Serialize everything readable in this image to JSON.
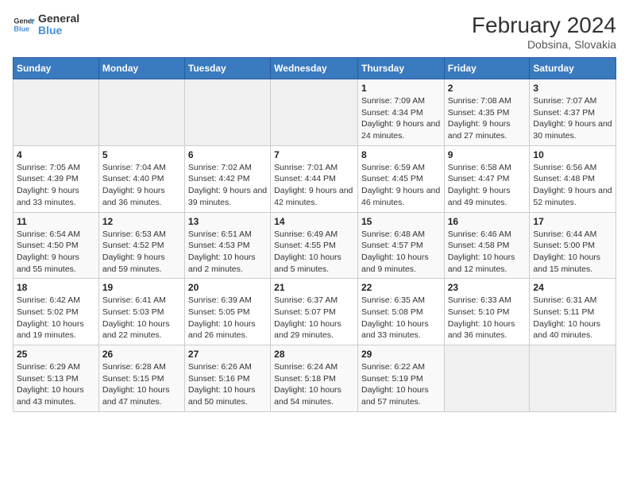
{
  "header": {
    "logo_line1": "General",
    "logo_line2": "Blue",
    "title": "February 2024",
    "subtitle": "Dobsina, Slovakia"
  },
  "weekdays": [
    "Sunday",
    "Monday",
    "Tuesday",
    "Wednesday",
    "Thursday",
    "Friday",
    "Saturday"
  ],
  "rows": [
    [
      {
        "empty": true
      },
      {
        "empty": true
      },
      {
        "empty": true
      },
      {
        "empty": true
      },
      {
        "day": 1,
        "sunrise": "7:09 AM",
        "sunset": "4:34 PM",
        "daylight": "9 hours and 24 minutes."
      },
      {
        "day": 2,
        "sunrise": "7:08 AM",
        "sunset": "4:35 PM",
        "daylight": "9 hours and 27 minutes."
      },
      {
        "day": 3,
        "sunrise": "7:07 AM",
        "sunset": "4:37 PM",
        "daylight": "9 hours and 30 minutes."
      }
    ],
    [
      {
        "day": 4,
        "sunrise": "7:05 AM",
        "sunset": "4:39 PM",
        "daylight": "9 hours and 33 minutes."
      },
      {
        "day": 5,
        "sunrise": "7:04 AM",
        "sunset": "4:40 PM",
        "daylight": "9 hours and 36 minutes."
      },
      {
        "day": 6,
        "sunrise": "7:02 AM",
        "sunset": "4:42 PM",
        "daylight": "9 hours and 39 minutes."
      },
      {
        "day": 7,
        "sunrise": "7:01 AM",
        "sunset": "4:44 PM",
        "daylight": "9 hours and 42 minutes."
      },
      {
        "day": 8,
        "sunrise": "6:59 AM",
        "sunset": "4:45 PM",
        "daylight": "9 hours and 46 minutes."
      },
      {
        "day": 9,
        "sunrise": "6:58 AM",
        "sunset": "4:47 PM",
        "daylight": "9 hours and 49 minutes."
      },
      {
        "day": 10,
        "sunrise": "6:56 AM",
        "sunset": "4:48 PM",
        "daylight": "9 hours and 52 minutes."
      }
    ],
    [
      {
        "day": 11,
        "sunrise": "6:54 AM",
        "sunset": "4:50 PM",
        "daylight": "9 hours and 55 minutes."
      },
      {
        "day": 12,
        "sunrise": "6:53 AM",
        "sunset": "4:52 PM",
        "daylight": "9 hours and 59 minutes."
      },
      {
        "day": 13,
        "sunrise": "6:51 AM",
        "sunset": "4:53 PM",
        "daylight": "10 hours and 2 minutes."
      },
      {
        "day": 14,
        "sunrise": "6:49 AM",
        "sunset": "4:55 PM",
        "daylight": "10 hours and 5 minutes."
      },
      {
        "day": 15,
        "sunrise": "6:48 AM",
        "sunset": "4:57 PM",
        "daylight": "10 hours and 9 minutes."
      },
      {
        "day": 16,
        "sunrise": "6:46 AM",
        "sunset": "4:58 PM",
        "daylight": "10 hours and 12 minutes."
      },
      {
        "day": 17,
        "sunrise": "6:44 AM",
        "sunset": "5:00 PM",
        "daylight": "10 hours and 15 minutes."
      }
    ],
    [
      {
        "day": 18,
        "sunrise": "6:42 AM",
        "sunset": "5:02 PM",
        "daylight": "10 hours and 19 minutes."
      },
      {
        "day": 19,
        "sunrise": "6:41 AM",
        "sunset": "5:03 PM",
        "daylight": "10 hours and 22 minutes."
      },
      {
        "day": 20,
        "sunrise": "6:39 AM",
        "sunset": "5:05 PM",
        "daylight": "10 hours and 26 minutes."
      },
      {
        "day": 21,
        "sunrise": "6:37 AM",
        "sunset": "5:07 PM",
        "daylight": "10 hours and 29 minutes."
      },
      {
        "day": 22,
        "sunrise": "6:35 AM",
        "sunset": "5:08 PM",
        "daylight": "10 hours and 33 minutes."
      },
      {
        "day": 23,
        "sunrise": "6:33 AM",
        "sunset": "5:10 PM",
        "daylight": "10 hours and 36 minutes."
      },
      {
        "day": 24,
        "sunrise": "6:31 AM",
        "sunset": "5:11 PM",
        "daylight": "10 hours and 40 minutes."
      }
    ],
    [
      {
        "day": 25,
        "sunrise": "6:29 AM",
        "sunset": "5:13 PM",
        "daylight": "10 hours and 43 minutes."
      },
      {
        "day": 26,
        "sunrise": "6:28 AM",
        "sunset": "5:15 PM",
        "daylight": "10 hours and 47 minutes."
      },
      {
        "day": 27,
        "sunrise": "6:26 AM",
        "sunset": "5:16 PM",
        "daylight": "10 hours and 50 minutes."
      },
      {
        "day": 28,
        "sunrise": "6:24 AM",
        "sunset": "5:18 PM",
        "daylight": "10 hours and 54 minutes."
      },
      {
        "day": 29,
        "sunrise": "6:22 AM",
        "sunset": "5:19 PM",
        "daylight": "10 hours and 57 minutes."
      },
      {
        "empty": true
      },
      {
        "empty": true
      }
    ]
  ],
  "labels": {
    "sunrise": "Sunrise:",
    "sunset": "Sunset:",
    "daylight": "Daylight:"
  }
}
